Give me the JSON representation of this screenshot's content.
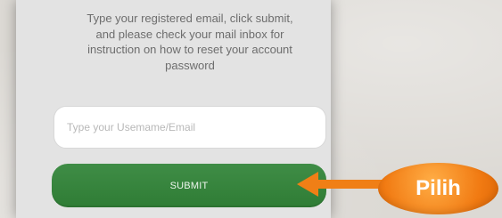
{
  "instructions": {
    "text": "Type your registered email, click submit,\nand please check your mail inbox for\ninstruction on how to reset your account\npassword"
  },
  "form": {
    "username_placeholder": "Type your Usemame/Email",
    "username_value": "",
    "submit_label": "SUBMIT"
  },
  "callout": {
    "label": "Pilih"
  },
  "colors": {
    "submit_bg": "#2f7c35",
    "callout_orange": "#f17a12",
    "page_bg": "#dcd9d4",
    "card_bg": "#e3e3e3"
  }
}
